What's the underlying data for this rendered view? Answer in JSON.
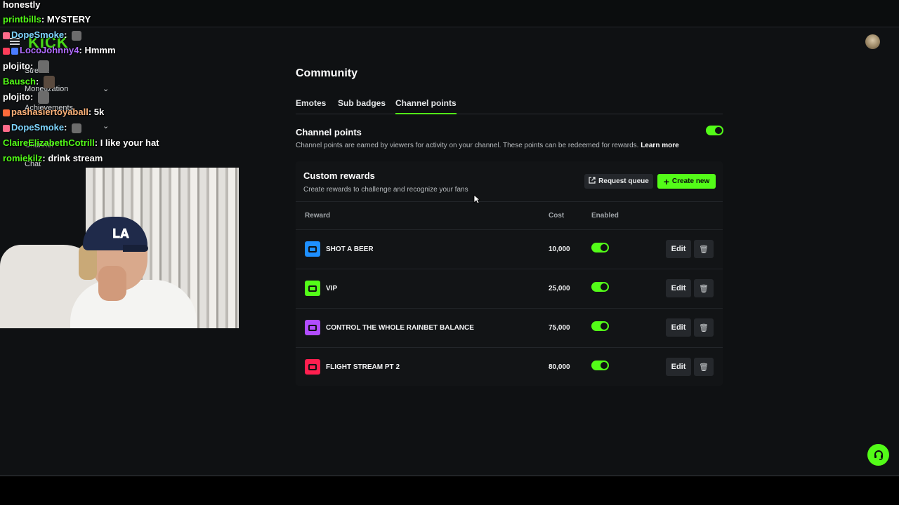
{
  "top_chat_word": "honestly",
  "sidebar": {
    "items": [
      {
        "label": "Strea...",
        "icon": "stream-icon"
      },
      {
        "label": "Monetization",
        "icon": "monetization-icon"
      },
      {
        "label": "Achievements",
        "icon": "achievement-icon"
      },
      {
        "label": "Channel",
        "icon": "channel-icon"
      },
      {
        "label": "Chat",
        "icon": "chat-icon"
      }
    ],
    "logo": "KICK"
  },
  "chat": [
    {
      "user": "printbills",
      "user_color": "#53fc18",
      "msg": "MYSTERY"
    },
    {
      "user": "DopeSmoke",
      "user_color": "#7fd6ff",
      "msg": ""
    },
    {
      "user": "LocoJohnny4",
      "user_color": "#b06cff",
      "msg": "Hmmm"
    },
    {
      "user": "plojito",
      "user_color": "#ffffff",
      "msg": ""
    },
    {
      "user": "Bausch",
      "user_color": "#53fc18",
      "msg": ""
    },
    {
      "user": "plojito",
      "user_color": "#ffffff",
      "msg": ""
    },
    {
      "user": "pashasiertoyaball",
      "user_color": "#ffb37a",
      "msg": "5k"
    },
    {
      "user": "DopeSmoke",
      "user_color": "#7fd6ff",
      "msg": ""
    },
    {
      "user": "ClaireElizabethCotrill",
      "user_color": "#53fc18",
      "msg": "I like your hat"
    },
    {
      "user": "romiekilz",
      "user_color": "#53fc18",
      "msg": "drink stream"
    }
  ],
  "page": {
    "title": "Community",
    "tabs": [
      {
        "label": "Emotes"
      },
      {
        "label": "Sub badges"
      },
      {
        "label": "Channel points"
      }
    ],
    "active_tab": "Channel points"
  },
  "channel_points": {
    "title": "Channel points",
    "description": "Channel points are earned by viewers for activity on your channel. These points can be redeemed for rewards.",
    "learn_more": "Learn more",
    "enabled": true
  },
  "custom_rewards": {
    "title": "Custom rewards",
    "subtitle": "Create rewards to challenge and recognize your fans",
    "request_queue_label": "Request queue",
    "create_new_label": "Create new",
    "columns": {
      "reward": "Reward",
      "cost": "Cost",
      "enabled": "Enabled"
    },
    "rows": [
      {
        "name": "SHOT A BEER",
        "cost": "10,000",
        "enabled": true,
        "color": "#1e8fff"
      },
      {
        "name": "VIP",
        "cost": "25,000",
        "enabled": true,
        "color": "#53fc18"
      },
      {
        "name": "CONTROL THE WHOLE RAINBET BALANCE",
        "cost": "75,000",
        "enabled": true,
        "color": "#b14cff"
      },
      {
        "name": "FLIGHT STREAM PT 2",
        "cost": "80,000",
        "enabled": true,
        "color": "#ff1f4f"
      }
    ],
    "edit_label": "Edit"
  },
  "colors": {
    "accent": "#53fc18",
    "background": "#0f1113",
    "card": "#121416"
  }
}
